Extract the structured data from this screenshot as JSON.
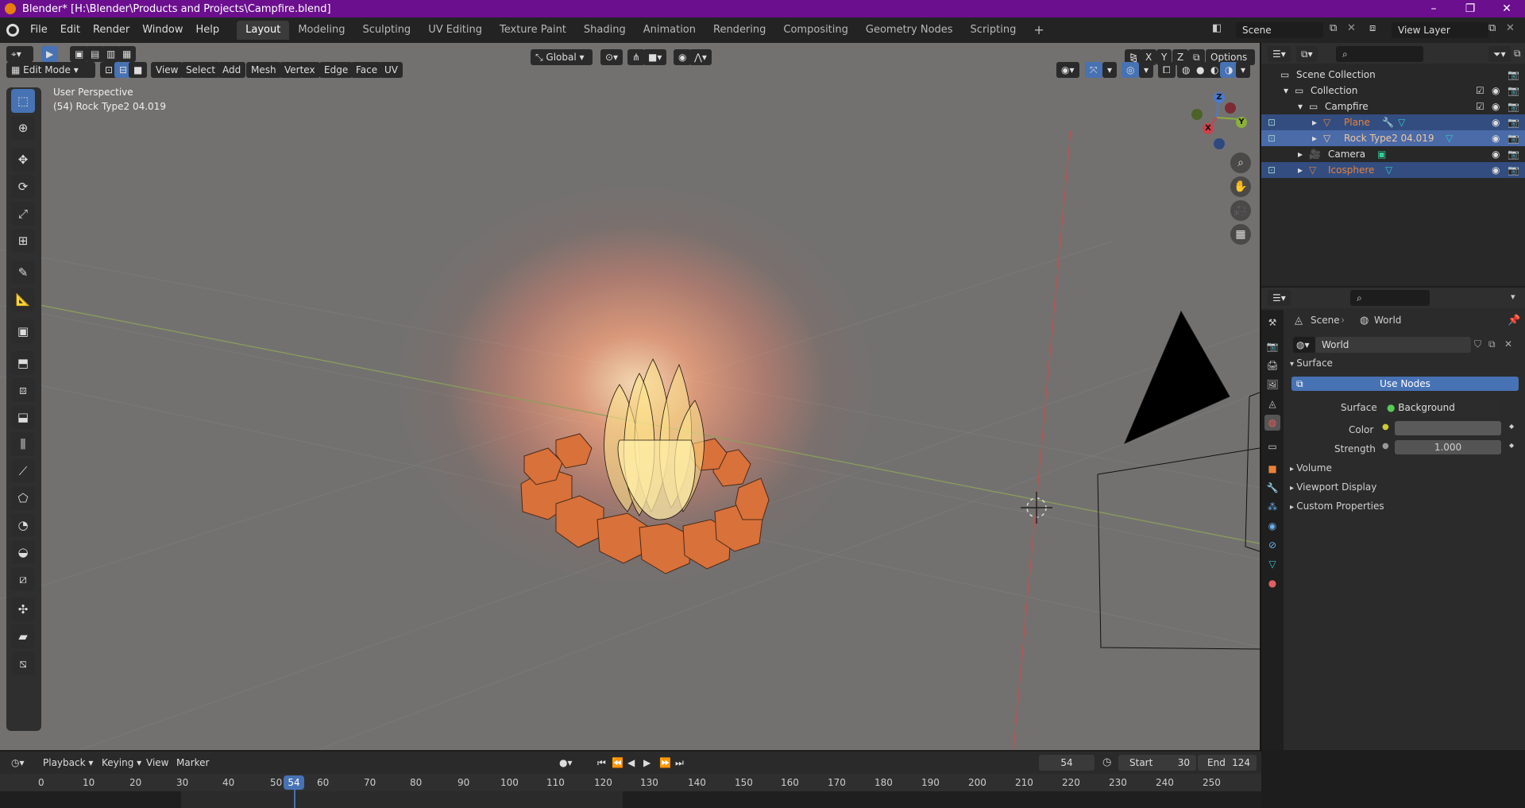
{
  "window": {
    "title": "Blender* [H:\\Blender\\Products and Projects\\Campfire.blend]",
    "minimize": "–",
    "maximize": "❐",
    "close": "✕"
  },
  "topbar": {
    "menus": [
      "File",
      "Edit",
      "Render",
      "Window",
      "Help"
    ],
    "workspaces": [
      "Layout",
      "Modeling",
      "Sculpting",
      "UV Editing",
      "Texture Paint",
      "Shading",
      "Animation",
      "Rendering",
      "Compositing",
      "Geometry Nodes",
      "Scripting"
    ],
    "active_workspace": "Layout",
    "add_tab": "+",
    "scene": "Scene",
    "view_layer": "View Layer"
  },
  "viewport": {
    "mode": "Edit Mode",
    "menus": [
      "View",
      "Select",
      "Add",
      "Mesh",
      "Vertex",
      "Edge",
      "Face",
      "UV"
    ],
    "transform_orientation": "Global",
    "options": "Options",
    "axis_toggles": [
      "X",
      "Y",
      "Z"
    ],
    "overlay_text_1": "User Perspective",
    "overlay_text_2": "(54) Rock Type2 04.019",
    "gizmo": {
      "z": "Z",
      "y": "Y",
      "x": "X"
    }
  },
  "outliner": {
    "rows": [
      {
        "label": "Scene Collection",
        "depth": 0,
        "selected": false,
        "color": "#dddddd"
      },
      {
        "label": "Collection",
        "depth": 1,
        "selected": false,
        "color": "#dddddd"
      },
      {
        "label": "Campfire",
        "depth": 2,
        "selected": false,
        "color": "#dddddd"
      },
      {
        "label": "Plane",
        "depth": 3,
        "selected": true,
        "color": "#e8823a"
      },
      {
        "label": "Rock Type2 04.019",
        "depth": 3,
        "selected": true,
        "color": "#f0c8a0"
      },
      {
        "label": "Camera",
        "depth": 2,
        "selected": false,
        "color": "#dddddd"
      },
      {
        "label": "Icosphere",
        "depth": 2,
        "selected": true,
        "color": "#e8823a"
      }
    ]
  },
  "properties": {
    "breadcrumb_scene": "Scene",
    "breadcrumb_sep": "›",
    "breadcrumb_world": "World",
    "world_name": "World",
    "panel_surface": "Surface",
    "use_nodes": "Use Nodes",
    "surface_label": "Surface",
    "surface_value": "Background",
    "color_label": "Color",
    "strength_label": "Strength",
    "strength_value": "1.000",
    "collapsed_panels": [
      "Volume",
      "Viewport Display",
      "Custom Properties"
    ]
  },
  "timeline": {
    "menus": [
      "Playback",
      "Keying",
      "View",
      "Marker"
    ],
    "current_frame": "54",
    "start_label": "Start",
    "start_value": "30",
    "end_label": "End",
    "end_value": "124",
    "ticks": [
      "0",
      "10",
      "20",
      "30",
      "40",
      "50",
      "60",
      "70",
      "80",
      "90",
      "100",
      "110",
      "120",
      "130",
      "140",
      "150",
      "160",
      "170",
      "180",
      "190",
      "200",
      "210",
      "220",
      "230",
      "240",
      "250"
    ],
    "current_marker": "54"
  }
}
